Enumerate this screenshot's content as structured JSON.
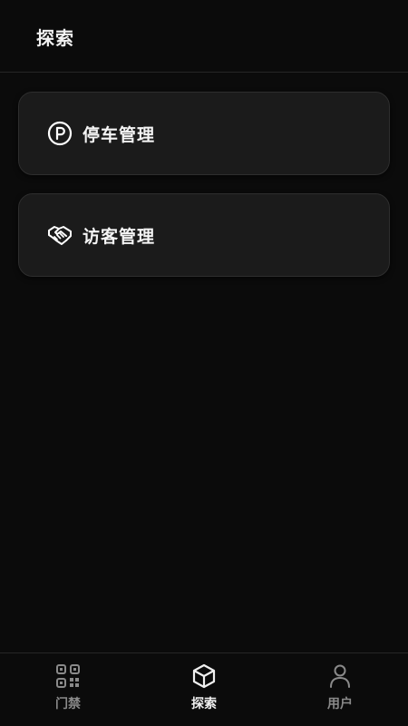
{
  "header": {
    "title": "探索"
  },
  "cards": [
    {
      "label": "停车管理",
      "icon": "parking-icon"
    },
    {
      "label": "访客管理",
      "icon": "handshake-icon"
    }
  ],
  "tabbar": {
    "tabs": [
      {
        "label": "门禁",
        "icon": "qr-code-icon",
        "active": false
      },
      {
        "label": "探索",
        "icon": "cube-icon",
        "active": true
      },
      {
        "label": "用户",
        "icon": "user-icon",
        "active": false
      }
    ]
  },
  "colors": {
    "background": "#0b0b0b",
    "card": "#1b1b1b",
    "active": "#f0f0f0",
    "inactive": "#8a8a8a"
  }
}
